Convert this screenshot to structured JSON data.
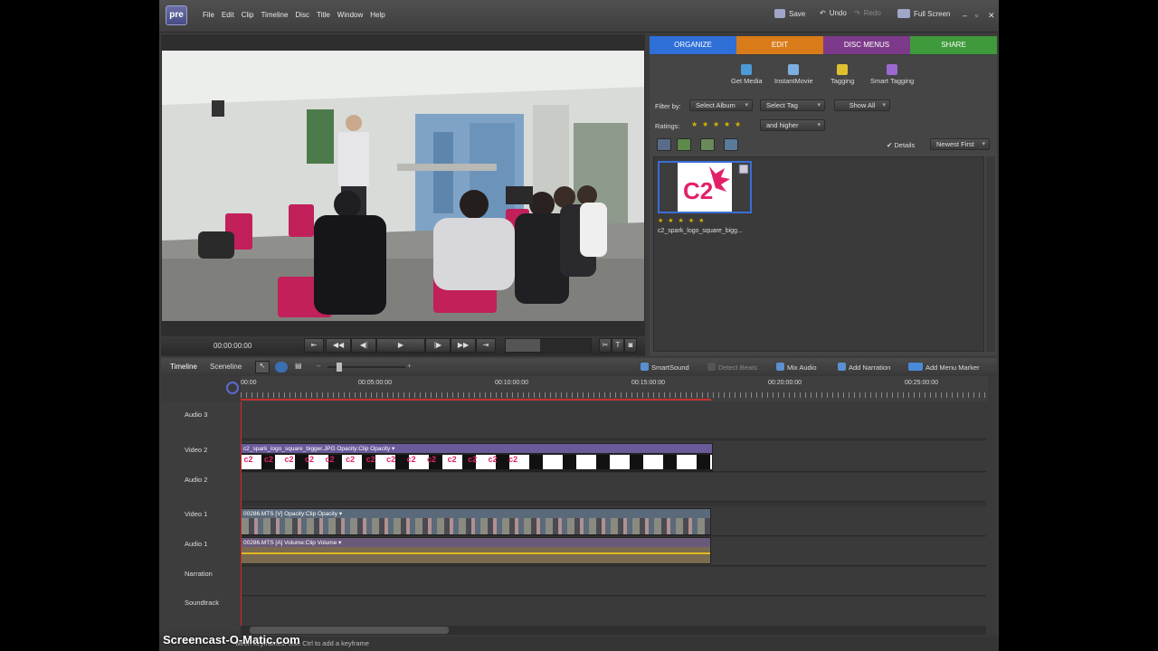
{
  "app": {
    "logo": "pre"
  },
  "menu": [
    "File",
    "Edit",
    "Clip",
    "Timeline",
    "Disc",
    "Title",
    "Window",
    "Help"
  ],
  "toolbar": {
    "save": "Save",
    "undo": "Undo",
    "redo": "Redo",
    "full_screen": "Full Screen"
  },
  "monitor": {
    "timecode": "00:00:00:00",
    "volume_percent": 40
  },
  "tabs": [
    {
      "label": "ORGANIZE",
      "color": "#2f6fd8"
    },
    {
      "label": "EDIT",
      "color": "#d97b18"
    },
    {
      "label": "DISC MENUS",
      "color": "#7d3a8a"
    },
    {
      "label": "SHARE",
      "color": "#3e9a3a"
    }
  ],
  "organizer": {
    "tools": [
      {
        "label": "Get Media",
        "icon": "get-media-icon",
        "color": "#4c9ad8"
      },
      {
        "label": "InstantMovie",
        "icon": "instant-movie-icon",
        "color": "#7db0e0"
      },
      {
        "label": "Tagging",
        "icon": "tagging-icon",
        "color": "#e0c030"
      },
      {
        "label": "Smart Tagging",
        "icon": "smart-tagging-icon",
        "color": "#9a6ad0"
      }
    ],
    "filter_by_label": "Filter by:",
    "select_album": "Select Album",
    "select_tag": "Select Tag",
    "show_all": "Show All",
    "ratings_label": "Ratings:",
    "rating_filter": "and higher",
    "details_label": "Details",
    "sort": "Newest First",
    "media": [
      {
        "name": "c2_spark_logo_square_bigg...",
        "thumb_text": "C2",
        "stars": 5
      }
    ]
  },
  "timeline": {
    "tab_timeline": "Timeline",
    "tab_sceneline": "Sceneline",
    "actions": [
      "SmartSound",
      "Detect Beats",
      "Mix Audio",
      "Add Narration",
      "Add Menu Marker"
    ],
    "ruler": [
      "00:00",
      "00:05:00:00",
      "00:10:00:00",
      "00:15:00:00",
      "00:20:00:00",
      "00:25:00:00"
    ],
    "tracks": [
      "Audio 3",
      "Video 2",
      "Audio 2",
      "Video 1",
      "Audio 1",
      "Narration",
      "Soundtrack"
    ],
    "clips": {
      "video2": "c2_spark_logo_square_bigger.JPG  Opacity:Clip Opacity ▾",
      "video1": "00286.MTS [V]  Opacity:Clip Opacity ▾",
      "audio1": "00286.MTS [A]  Volume:Clip Volume ▾"
    }
  },
  "status": "ween keyframes. Use Ctrl to add a keyframe",
  "watermark": "Screencast-O-Matic.com"
}
